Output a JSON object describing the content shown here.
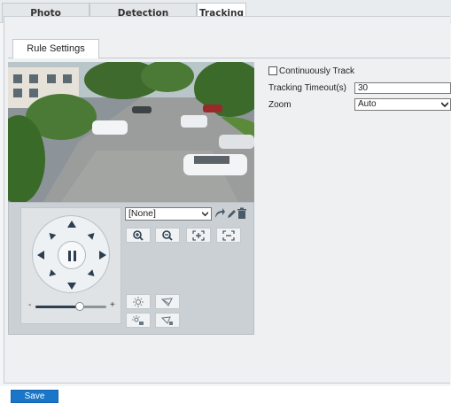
{
  "tabs": {
    "photo_parameters": "Photo Parameters",
    "detection_parameters": "Detection Parameters",
    "tracking": "Tracking"
  },
  "subtab": {
    "rule_settings": "Rule Settings"
  },
  "ptz": {
    "preset_value": "[None]",
    "zoom_slider_level": 0.62,
    "slider_minus": "-",
    "slider_plus": "+"
  },
  "form": {
    "continuously_track_label": "Continuously Track",
    "continuously_track_checked": false,
    "tracking_timeout_label": "Tracking Timeout(s)",
    "tracking_timeout_value": "30",
    "zoom_label": "Zoom",
    "zoom_value": "Auto"
  },
  "actions": {
    "save_label": "Save"
  },
  "colors": {
    "accent": "#1976c8",
    "panel_bg": "#eef0f2",
    "ptz_bg": "#cbd0d5"
  }
}
